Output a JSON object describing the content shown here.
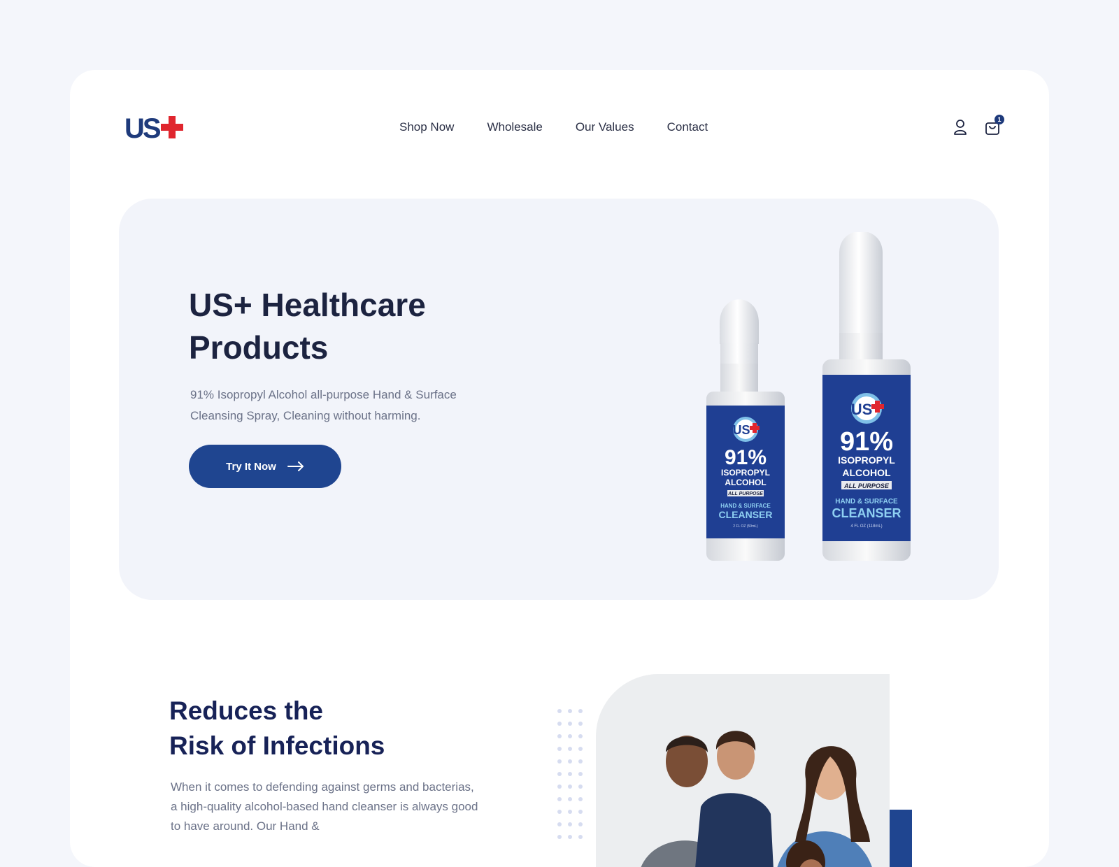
{
  "brand": {
    "logo_text": "US",
    "accent_color": "#e0262e",
    "primary_color": "#1e3a7b"
  },
  "nav": {
    "items": [
      "Shop Now",
      "Wholesale",
      "Our Values",
      "Contact"
    ]
  },
  "header": {
    "cart_count": "1",
    "account_icon": "user-icon",
    "cart_icon": "shopping-bag-icon"
  },
  "hero": {
    "title_line1": "US+ Healthcare",
    "title_line2": "Products",
    "subtitle": "91% Isopropyl Alcohol all-purpose Hand & Surface Cleansing Spray, Cleaning without harming.",
    "cta_label": "Try It Now"
  },
  "product_labels": {
    "logo": "US",
    "percent": "91%",
    "line1": "ISOPROPYL",
    "line2": "ALCOHOL",
    "tag": "ALL PURPOSE",
    "use": "HAND & SURFACE",
    "type": "CLEANSER",
    "small_volume": "2 FL OZ (59mL)",
    "large_volume": "4 FL OZ (118mL)"
  },
  "section": {
    "title_line1": "Reduces the",
    "title_line2": "Risk of Infections",
    "text": "When it comes to defending against germs and bacterias, a high-quality alcohol-based hand cleanser is always good to have around. Our Hand &"
  }
}
